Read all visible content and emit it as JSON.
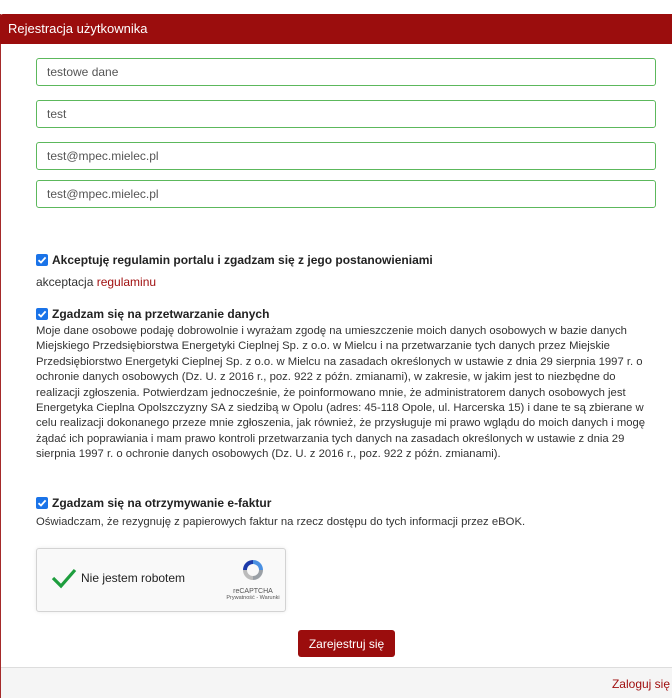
{
  "panel": {
    "title": "Rejestracja użytkownika"
  },
  "fields": [
    {
      "value": "testowe dane"
    },
    {
      "value": "test"
    },
    {
      "value": "test@mpec.mielec.pl"
    },
    {
      "value": "test@mpec.mielec.pl"
    }
  ],
  "terms": {
    "label": "Akceptuję regulamin portalu i zgadzam się z jego postanowieniami",
    "note_prefix": "akceptacja ",
    "note_link": "regulaminu",
    "checked": true
  },
  "data_processing": {
    "label": "Zgadzam się na przetwarzanie danych",
    "text": "Moje dane osobowe podaję dobrowolnie i wyrażam zgodę na umieszczenie moich danych osobowych w bazie danych Miejskiego Przedsiębiorstwa Energetyki Cieplnej Sp. z o.o. w Mielcu i na przetwarzanie tych danych przez Miejskie Przedsiębiorstwo Energetyki Cieplnej Sp. z o.o. w Mielcu na zasadach określonych w ustawie z dnia 29 sierpnia 1997 r. o ochronie danych osobowych (Dz. U. z 2016 r., poz. 922 z późn. zmianami), w zakresie, w jakim jest to niezbędne do realizacji zgłoszenia. Potwierdzam jednocześnie, że poinformowano mnie, że administratorem danych osobowych jest Energetyka Cieplna Opolszczyzny SA z siedzibą w Opolu (adres: 45-118 Opole, ul. Harcerska 15) i dane te są zbierane w celu realizacji dokonanego przeze mnie zgłoszenia, jak również, że przysługuje mi prawo wglądu do moich danych i mogę żądać ich poprawiania i mam prawo kontroli przetwarzania tych danych na zasadach określonych w ustawie z dnia 29 sierpnia 1997 r. o ochronie danych osobowych (Dz. U. z 2016 r., poz. 922 z późn. zmianami).",
    "checked": true
  },
  "einvoice": {
    "label": "Zgadzam się na otrzymywanie e-faktur",
    "text": "Oświadczam, że rezygnuję z papierowych faktur na rzecz dostępu do tych informacji przez eBOK.",
    "checked": true
  },
  "captcha": {
    "label": "Nie jestem robotem",
    "brand": "reCAPTCHA",
    "links": "Prywatność - Warunki",
    "check_icon": "check-icon",
    "logo_icon": "recaptcha-logo-icon"
  },
  "submit_label": "Zarejestruj się",
  "footer": {
    "login_link": "Zaloguj się"
  },
  "colors": {
    "brand": "#9b0d0d",
    "field_border": "#5cb85c",
    "checkbox": "#1a73e8"
  }
}
